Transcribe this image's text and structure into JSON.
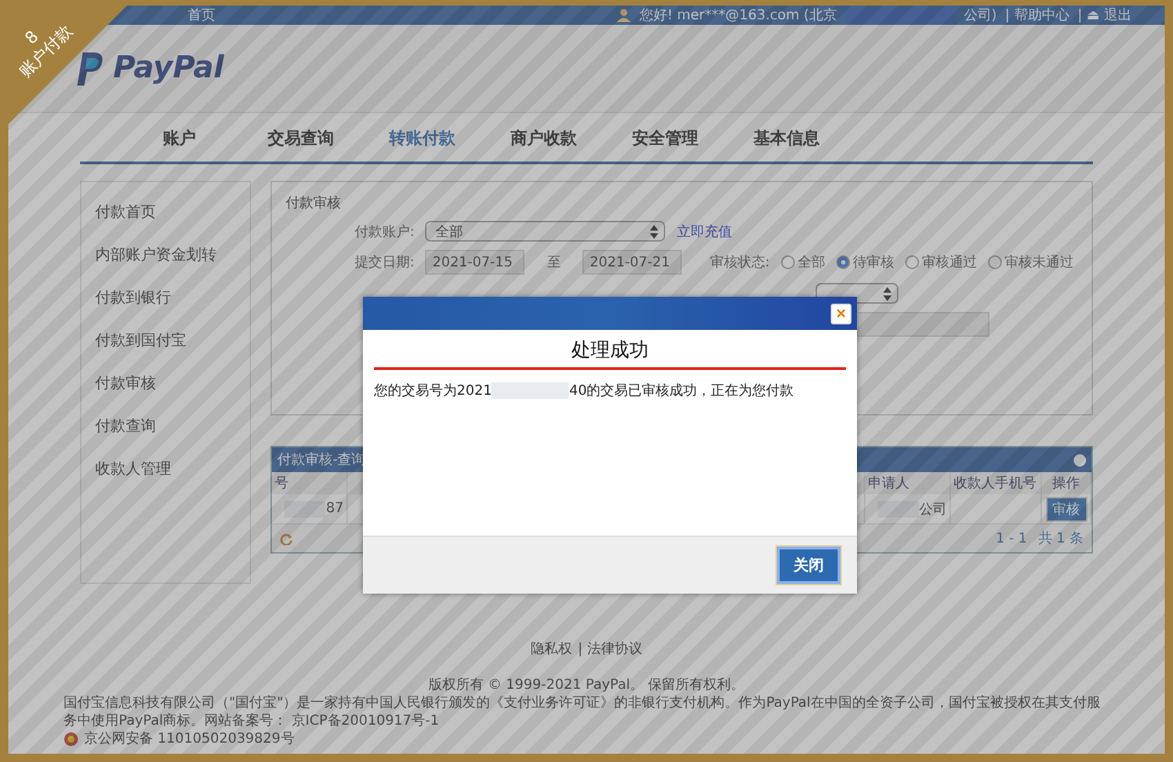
{
  "corner_badge": {
    "number": "8",
    "label": "账户付款"
  },
  "top_bar": {
    "home": "首页",
    "greeting": "您好! mer***@163.com (北京",
    "company_suffix": "公司)",
    "links": [
      {
        "label": "| 帮助中心"
      },
      {
        "label": "| ⏏ 退出"
      }
    ]
  },
  "logo": {
    "text": "PayPal"
  },
  "nav": [
    {
      "label": "账户",
      "selected": false
    },
    {
      "label": "交易查询",
      "selected": false
    },
    {
      "label": "转账付款",
      "selected": true
    },
    {
      "label": "商户收款",
      "selected": false
    },
    {
      "label": "安全管理",
      "selected": false
    },
    {
      "label": "基本信息",
      "selected": false
    }
  ],
  "sidebar": {
    "items": [
      {
        "label": "付款首页"
      },
      {
        "label": "内部账户资金划转"
      },
      {
        "label": "付款到银行"
      },
      {
        "label": "付款到国付宝"
      },
      {
        "label": "付款审核"
      },
      {
        "label": "付款查询"
      },
      {
        "label": "收款人管理"
      }
    ]
  },
  "filter": {
    "title": "付款审核",
    "account_label": "付款账户:",
    "account_value": "全部",
    "recharge_link": "立即充值",
    "date_label": "提交日期:",
    "date_from": "2021-07-15",
    "date_to_label": "至",
    "date_to": "2021-07-21",
    "status_label": "审核状态:",
    "status_options": [
      {
        "label": "全部",
        "selected": false
      },
      {
        "label": "待审核",
        "selected": true
      },
      {
        "label": "审核通过",
        "selected": false
      },
      {
        "label": "审核未通过",
        "selected": false
      }
    ]
  },
  "table": {
    "title": "付款审核-查询",
    "columns": [
      "号",
      "申请人",
      "收款人手机号",
      "操作"
    ],
    "rows": [
      {
        "number_suffix": "87",
        "applicant_suffix": "公司",
        "action": "审核"
      }
    ],
    "pager": "1 - 1",
    "total": "共 1 条"
  },
  "footer": {
    "links": [
      {
        "label": "隐私权"
      },
      {
        "label": "| 法律协议"
      }
    ],
    "copyright": "版权所有 © 1999-2021 PayPal。 保留所有权利。",
    "notice": "国付宝信息科技有限公司（\"国付宝\"）是一家持有中国人民银行颁发的《支付业务许可证》的非银行支付机构。作为PayPal在中国的全资子公司，国付宝被授权在其支付服务中使用PayPal商标。网站备案号： 京ICP备20010917号-1",
    "police": "京公网安备 11010502039829号"
  },
  "dialog": {
    "title": "处理成功",
    "message_before": "您的交易号为2021",
    "message_after": "40的交易已审核成功，正在为您付款",
    "close_label": "关闭",
    "close_icon": "×"
  }
}
